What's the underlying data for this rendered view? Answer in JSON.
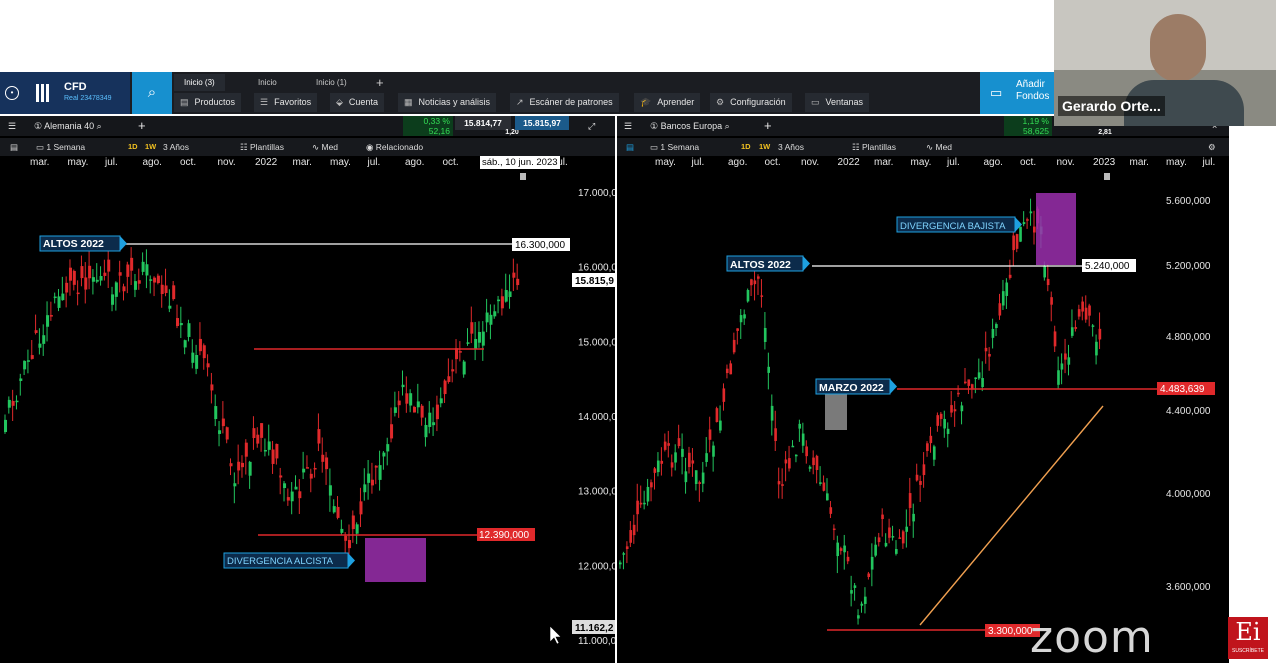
{
  "app": {
    "account_type": "CFD",
    "account": "Real 23478349"
  },
  "tabs": [
    "Inicio (3)",
    "Inicio",
    "Inicio (1)",
    "+"
  ],
  "nav": [
    "Productos",
    "Favoritos",
    "Cuenta",
    "Noticias y análisis",
    "Escáner de patrones",
    "Aprender",
    "Configuración",
    "Ventanas"
  ],
  "add_funds": "Añadir Fondos",
  "video": {
    "participant": "Gerardo Orte..."
  },
  "left_chart": {
    "symbol": "Alemania 40",
    "change_pct": "0,33 %",
    "change_abs": "52,16",
    "sell": "15.814,77",
    "spread": "1,20",
    "buy": "15.815,97",
    "toolbar": [
      "1 Semana",
      "1D",
      "1W",
      "3 Años",
      "Plantillas",
      "Med",
      "Relacionado"
    ],
    "months": [
      "mar.",
      "may.",
      "jul.",
      "ago.",
      "oct.",
      "nov.",
      "2022",
      "mar.",
      "may.",
      "jul.",
      "ago.",
      "oct.",
      "nov.",
      "2023",
      "jul."
    ],
    "date_tip": "sáb., 10 jun. 2023",
    "y_ticks": [
      "17.000,0",
      "16.000,0",
      "15.000,0",
      "14.000,0",
      "13.000,0",
      "12.000,0",
      "11.000,0"
    ],
    "price_label": "15.815,9",
    "low_label": "11.162,2",
    "highs_label": "ALTOS 2022",
    "highs_value": "16.300,000",
    "low_line_value": "12.390,000",
    "div_label": "DIVERGENCIA  ALCISTA"
  },
  "right_chart": {
    "symbol": "Bancos Europa",
    "change_pct": "1,19 %",
    "change_abs": "58,625",
    "spread": "2,81",
    "toolbar": [
      "1 Semana",
      "1D",
      "1W",
      "3 Años",
      "Plantillas",
      "Med"
    ],
    "months": [
      "may.",
      "jul.",
      "ago.",
      "oct.",
      "nov.",
      "2022",
      "mar.",
      "may.",
      "jul.",
      "ago.",
      "oct.",
      "nov.",
      "2023",
      "mar.",
      "may.",
      "jul."
    ],
    "y_ticks": [
      "5.600,000",
      "5.200,000",
      "4.800,000",
      "4.400,000",
      "4.000,000",
      "3.600,000"
    ],
    "highs_label": "ALTOS 2022",
    "highs_value": "5.240,000",
    "march_label": "MARZO 2022",
    "march_value": "4.483,639",
    "div_label": "DIVERGENCIA BAJISTA",
    "low_value": "3.300,000"
  },
  "watermark": "zoom",
  "brand": "Ei",
  "brand_sub": "SUSCRÍBETE",
  "colors": {
    "up": "#22c55e",
    "down": "#e0292b",
    "accent": "#1790cf",
    "div_box": "#9b2fae"
  }
}
